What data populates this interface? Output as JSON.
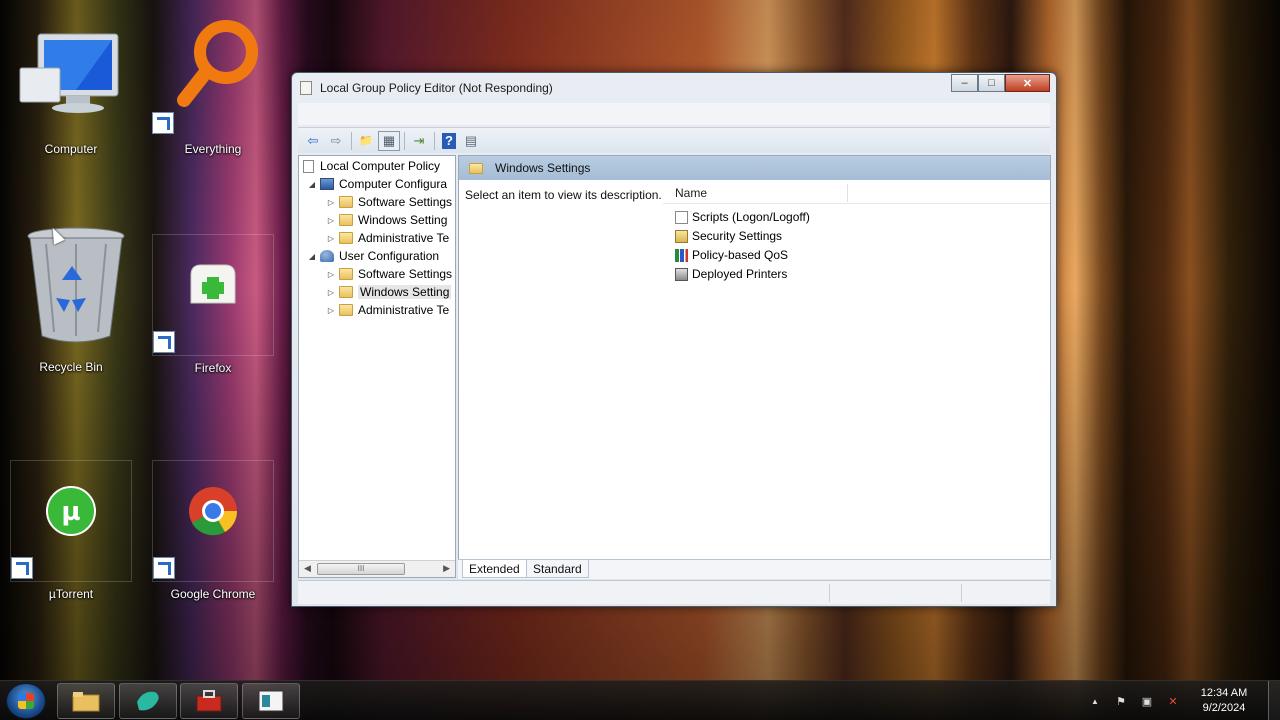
{
  "desktop": {
    "icons": [
      {
        "label": "Computer"
      },
      {
        "label": "Everything"
      },
      {
        "label": "Recycle Bin"
      },
      {
        "label": "Firefox"
      },
      {
        "label": "µTorrent"
      },
      {
        "label": "Google Chrome"
      }
    ]
  },
  "window": {
    "title": "Local Group Policy Editor (Not Responding)",
    "buttons": {
      "minimize": "–",
      "maximize": "□",
      "close": "✕"
    },
    "toolbar": [
      {
        "icon": "back-arrow-icon",
        "glyph": "⇦"
      },
      {
        "icon": "forward-arrow-icon",
        "glyph": "⇨"
      },
      {
        "icon": "up-folder-icon",
        "glyph": "📁"
      },
      {
        "icon": "show-hide-tree-icon",
        "glyph": "▦"
      },
      {
        "icon": "export-list-icon",
        "glyph": "⇥"
      },
      {
        "icon": "help-icon",
        "glyph": "?"
      },
      {
        "icon": "properties-icon",
        "glyph": "▤"
      }
    ],
    "tree": {
      "root": "Local Computer Policy",
      "items": [
        {
          "label": "Computer Configura",
          "level": 1,
          "arrow": "◢",
          "type": "computer"
        },
        {
          "label": "Software Settings",
          "level": 2,
          "arrow": "▷",
          "type": "folder"
        },
        {
          "label": "Windows Setting",
          "level": 2,
          "arrow": "▷",
          "type": "folder"
        },
        {
          "label": "Administrative Te",
          "level": 2,
          "arrow": "▷",
          "type": "folder"
        },
        {
          "label": "User Configuration",
          "level": 1,
          "arrow": "◢",
          "type": "user"
        },
        {
          "label": "Software Settings",
          "level": 2,
          "arrow": "▷",
          "type": "folder"
        },
        {
          "label": "Windows Setting",
          "level": 2,
          "arrow": "▷",
          "type": "folder",
          "selected": true
        },
        {
          "label": "Administrative Te",
          "level": 2,
          "arrow": "▷",
          "type": "folder"
        }
      ],
      "scroll_grip": "III",
      "scroll_left": "◀",
      "scroll_right": "▶"
    },
    "right_pane": {
      "header": "Windows Settings",
      "description": "Select an item to view its description.",
      "column_name": "Name",
      "items": [
        {
          "label": "Scripts (Logon/Logoff)",
          "icon": "script-icon"
        },
        {
          "label": "Security Settings",
          "icon": "security-settings-icon"
        },
        {
          "label": "Policy-based QoS",
          "icon": "qos-chart-icon"
        },
        {
          "label": "Deployed Printers",
          "icon": "printer-icon"
        }
      ]
    },
    "tabs": [
      "Extended",
      "Standard"
    ]
  },
  "taskbar": {
    "clock_time": "12:34 AM",
    "clock_date": "9/2/2024",
    "tray_glyphs": {
      "expand": "▲",
      "flag": "⚑",
      "network": "▣",
      "volume": "✕"
    }
  }
}
